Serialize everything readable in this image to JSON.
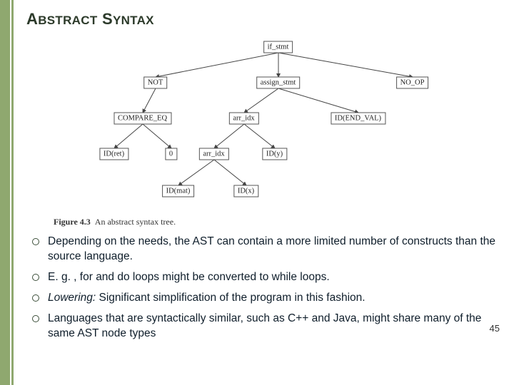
{
  "title": {
    "word1_big": "A",
    "word1_rest": "BSTRACT",
    "word2_big": "S",
    "word2_rest": "YNTAX"
  },
  "tree": {
    "if_stmt": "if_stmt",
    "not": "NOT",
    "assign_stmt": "assign_stmt",
    "no_op": "NO_OP",
    "compare_eq": "COMPARE_EQ",
    "arr_idx_top": "arr_idx",
    "id_endval": "ID(END_VAL)",
    "id_ret": "ID(ret)",
    "zero": "0",
    "arr_idx_mid": "arr_idx",
    "id_y": "ID(y)",
    "id_mat": "ID(mat)",
    "id_x": "ID(x)"
  },
  "caption": {
    "label": "Figure 4.3",
    "text": "An abstract syntax tree."
  },
  "bullets": [
    "Depending on the needs, the AST can contain a more limited number of constructs than the source language.",
    "E. g. , for and do loops might be converted to while loops.",
    "<em>Lowering:</em> Significant simplification of the program in this fashion.",
    "Languages that are syntactically similar, such as C++ and Java, might share many of the same AST node types"
  ],
  "page_number": "45"
}
